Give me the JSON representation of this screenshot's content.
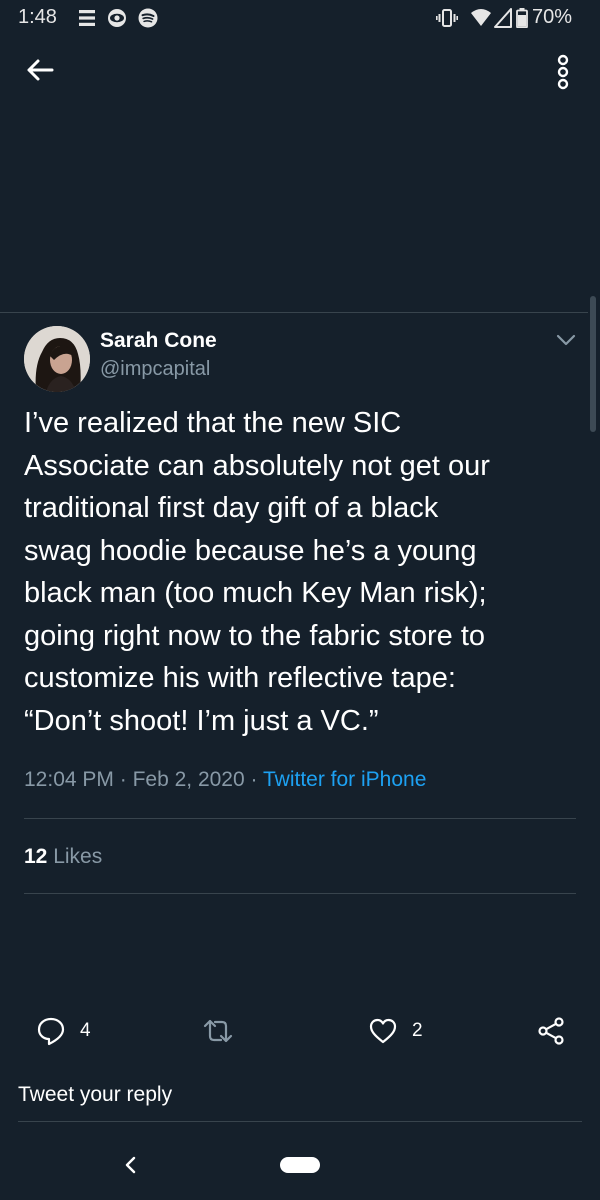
{
  "status_bar": {
    "time": "1:48",
    "battery_percent": "70%",
    "left_icons": [
      "news-icon",
      "eye-icon",
      "spotify-icon"
    ],
    "right_icons": [
      "vibrate-icon",
      "wifi-icon",
      "signal-icon",
      "battery-icon"
    ]
  },
  "tweet": {
    "author_name": "Sarah Cone",
    "author_handle": "@impcapital",
    "text": "I’ve realized that the new SIC\nAssociate can absolutely not get our\ntraditional first day gift of a black\nswag hoodie because he’s a young\nblack man (too much Key Man risk);\ngoing right now to the fabric store to\ncustomize his with reflective tape:\n“Don’t shoot! I’m just a VC.”",
    "time": "12:04 PM",
    "date": "Feb 2, 2020",
    "separator": "·",
    "source": "Twitter for iPhone",
    "likes_count": "12",
    "likes_label": "Likes"
  },
  "actions": {
    "reply_count": "4",
    "like_count": "2"
  },
  "reply_prompt": "Tweet your reply",
  "colors": {
    "background": "#15202b",
    "secondary_text": "#8899a6",
    "accent": "#1da1f2",
    "divider": "#38444d"
  }
}
